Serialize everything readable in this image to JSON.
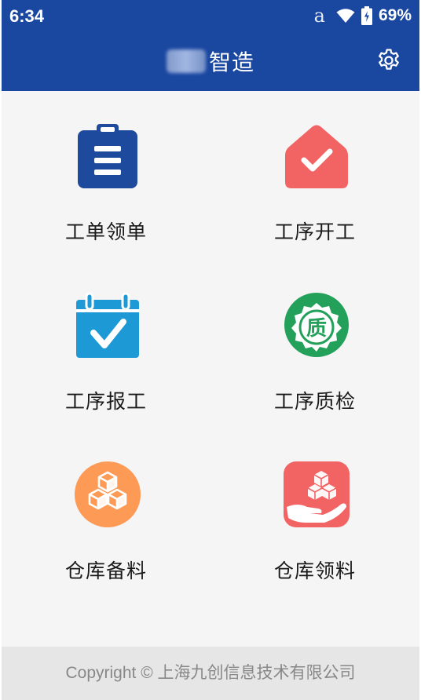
{
  "status_bar": {
    "time": "6:34",
    "notification_glyph": "a",
    "battery_percent": "69%",
    "icons": [
      "amazon-notification-icon",
      "wifi-icon",
      "battery-charging-icon"
    ]
  },
  "app_bar": {
    "title": "智造",
    "title_prefix_obscured": true,
    "settings_icon": "gear-icon",
    "background_color": "#1a47a0"
  },
  "menu": {
    "items": [
      {
        "label": "工单领单",
        "icon": "clipboard-icon",
        "color": "#1e4a9e"
      },
      {
        "label": "工序开工",
        "icon": "house-check-icon",
        "color": "#f26364"
      },
      {
        "label": "工序报工",
        "icon": "calendar-check-icon",
        "color": "#1d99d6"
      },
      {
        "label": "工序质检",
        "icon": "quality-badge-icon",
        "color": "#23a05a",
        "badge_text": "质"
      },
      {
        "label": "仓库备料",
        "icon": "boxes-stack-icon",
        "color": "#fd9b56"
      },
      {
        "label": "仓库领料",
        "icon": "hand-boxes-icon",
        "color": "#f26364"
      }
    ]
  },
  "footer": {
    "copyright": "Copyright © 上海九创信息技术有限公司"
  }
}
